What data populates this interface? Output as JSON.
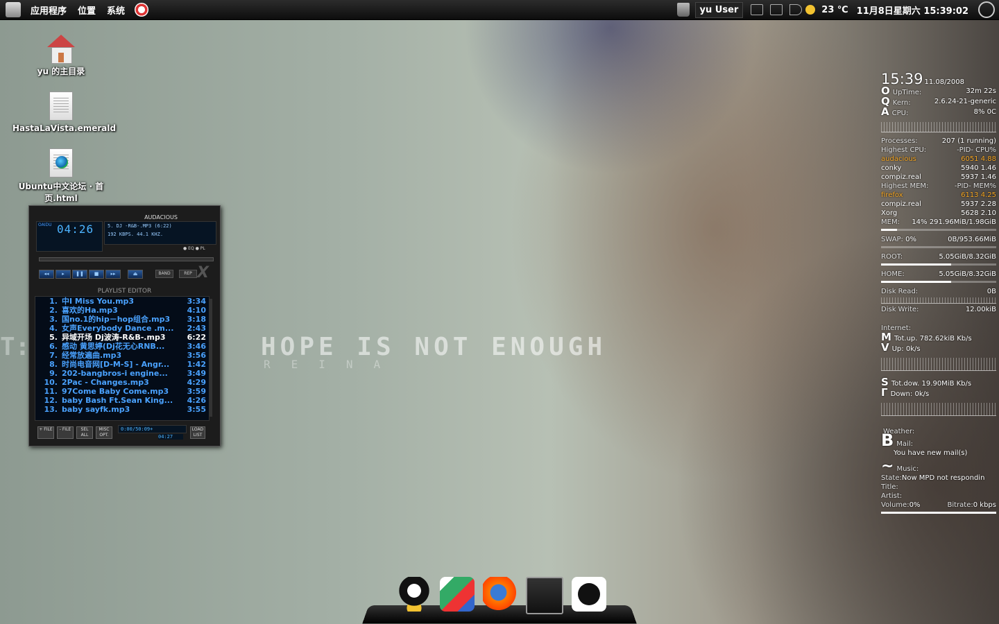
{
  "top_panel": {
    "menus": [
      "应用程序",
      "位置",
      "系统"
    ],
    "user": "yu User",
    "temperature": "23 ℃",
    "datetime": "11月8日星期六 15:39:02"
  },
  "desktop_icons": [
    {
      "label": "yu 的主目录"
    },
    {
      "label": "HastaLaVista.emerald"
    },
    {
      "label": "Ubuntu中文论坛 · 首页.html"
    }
  ],
  "player": {
    "title": "AUDACIOUS",
    "time": "04:26",
    "track_line": "5.       DJ   -R&B-.MP3 (6:22)",
    "bitrate_line": "192 KBPS.  44.1 KHZ.",
    "eq_label": "EQ",
    "pl_label": "PL",
    "band_label": "BAND",
    "rep_label": "REP",
    "playlist_title": "PLAYLIST EDITOR",
    "playlist": [
      {
        "num": "1.",
        "name": "中I Miss You.mp3",
        "dur": "3:34"
      },
      {
        "num": "2.",
        "name": "喜欢的Ha.mp3",
        "dur": "4:10"
      },
      {
        "num": "3.",
        "name": "国no.1的hip－hop组合.mp3",
        "dur": "3:18"
      },
      {
        "num": "4.",
        "name": "女声Everybody Dance .m...",
        "dur": "2:43"
      },
      {
        "num": "5.",
        "name": "异域开场 Dj波涛-R&B-.mp3",
        "dur": "6:22"
      },
      {
        "num": "6.",
        "name": "感动 黄思婷(Dj花无心RNB...",
        "dur": "3:46"
      },
      {
        "num": "7.",
        "name": "经常放遍曲.mp3",
        "dur": "3:56"
      },
      {
        "num": "8.",
        "name": "时尚电音网[D-M-S] - Angr...",
        "dur": "1:42"
      },
      {
        "num": "9.",
        "name": "202-bangbros-i engine...",
        "dur": "3:49"
      },
      {
        "num": "10.",
        "name": "2Pac - Changes.mp3",
        "dur": "4:29"
      },
      {
        "num": "11.",
        "name": "97Come Baby Come.mp3",
        "dur": "3:59"
      },
      {
        "num": "12.",
        "name": "baby Bash Ft.Sean King...",
        "dur": "4:26"
      },
      {
        "num": "13.",
        "name": "baby sayfk.mp3",
        "dur": "3:55"
      }
    ],
    "current_index": 4,
    "status_total": "0:00/50:09+",
    "status_time": "04:27",
    "buttons": [
      "+ FILE",
      "- FILE",
      "SEL ALL",
      "MISC OPT."
    ],
    "list_button": "LOAD LIST"
  },
  "wallpaper": {
    "main_text": "HOPE IS NOT ENOUGH",
    "sub_text": "REINA"
  },
  "conky": {
    "clock": "15:39",
    "date": "11.08/2008",
    "uptime_label": "UpTime:",
    "uptime": "32m 22s",
    "kern_label": "Kern:",
    "kern": "2.6.24-21-generic",
    "cpu_label": "CPU:",
    "cpu": "8% 0C",
    "processes_label": "Processes:",
    "processes": "207 (1 running)",
    "top_cpu_header": "Highest CPU:",
    "pid_cpu_header": "-PID-  CPU%",
    "top_cpu": [
      {
        "name": "audacious",
        "pid": "6051",
        "val": "4.88"
      },
      {
        "name": "conky",
        "pid": "5940",
        "val": "1.46"
      },
      {
        "name": "compiz.real",
        "pid": "5937",
        "val": "1.46"
      }
    ],
    "top_mem_header": "Highest MEM:",
    "pid_mem_header": "-PID-  MEM%",
    "top_mem": [
      {
        "name": "firefox",
        "pid": "6113",
        "val": "4.25"
      },
      {
        "name": "compiz.real",
        "pid": "5937",
        "val": "2.28"
      },
      {
        "name": "Xorg",
        "pid": "5628",
        "val": "2.10"
      }
    ],
    "mem_label": "MEM:",
    "mem": "14%  291.96MiB/1.98GiB",
    "mem_fraction": 0.14,
    "swap_label": "SWAP:",
    "swap_pct": "0%",
    "swap": "0B/953.66MiB",
    "swap_fraction": 0.0,
    "root_label": "ROOT:",
    "root": "5.05GiB/8.32GiB",
    "root_fraction": 0.61,
    "home_label": "HOME:",
    "home": "5.05GiB/8.32GiB",
    "home_fraction": 0.61,
    "disk_read_label": "Disk Read:",
    "disk_read": "0B",
    "disk_write_label": "Disk Write:",
    "disk_write": "12.00kiB",
    "internet_label": "Internet:",
    "tot_up_label": "Tot.up.",
    "tot_up": "782.62kiB Kb/s",
    "up_label": "Up:",
    "up": "0k/s",
    "tot_down_label": "Tot.dow.",
    "tot_down": "19.90MiB Kb/s",
    "down_label": "Down:",
    "down": "0k/s",
    "weather_label": "Weather:",
    "mail_label": "Mail:",
    "mail_text": "You have  new mail(s)",
    "music_label": "Music:",
    "state_label": "State:",
    "state": "Now MPD not respondin",
    "title_label": "Title:",
    "artist_label": "Artist:",
    "volume_label": "Volume:",
    "volume": "0%",
    "bitrate_label": "Bitrate:",
    "bitrate": "0 kbps",
    "glyphs": {
      "uptime": "O",
      "kern": "Q",
      "cpu": "A",
      "up1": "M",
      "up2": "V",
      "down1": "S",
      "down2": "Γ",
      "mail": "B",
      "music": "~"
    }
  },
  "dock": {
    "icons": [
      "qq-icon",
      "movie-icon",
      "firefox-icon",
      "terminal-icon",
      "audacious-icon"
    ]
  }
}
